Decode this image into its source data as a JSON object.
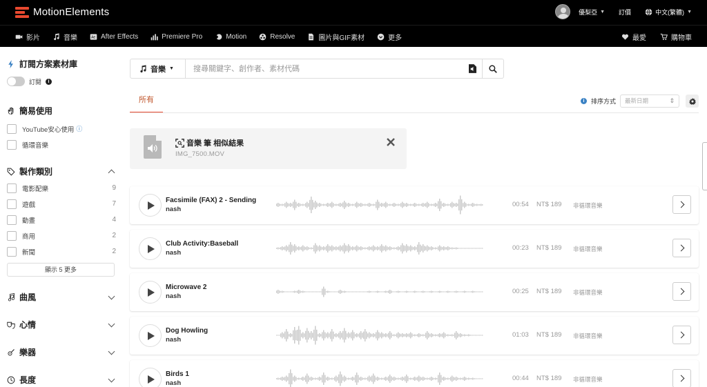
{
  "header": {
    "brand": "MotionElements",
    "username": "優梨亞",
    "subscribe": "訂價",
    "language": "中文(繁體)",
    "nav": [
      {
        "label": "影片",
        "icon": "video-icon"
      },
      {
        "label": "音樂",
        "icon": "music-note-icon"
      },
      {
        "label": "After Effects",
        "icon": "ae-icon"
      },
      {
        "label": "Premiere Pro",
        "icon": "premiere-icon"
      },
      {
        "label": "Motion",
        "icon": "motion-icon"
      },
      {
        "label": "Resolve",
        "icon": "resolve-icon"
      },
      {
        "label": "圖片與GIF素材",
        "icon": "image-icon"
      },
      {
        "label": "更多",
        "icon": "more-icon"
      }
    ],
    "favorites": "最愛",
    "cart": "購物車"
  },
  "sidebar": {
    "subscription_title": "訂閱方案素材庫",
    "subscription_toggle": "訂閱",
    "easy_use_title": "簡易使用",
    "easy_use_items": [
      {
        "label": "YouTube安心使用",
        "info": "ⓘ"
      },
      {
        "label": "循環音樂"
      }
    ],
    "category_title": "製作類別",
    "categories": [
      {
        "label": "電影配樂",
        "count": "9"
      },
      {
        "label": "遊戲",
        "count": "7"
      },
      {
        "label": "動畫",
        "count": "4"
      },
      {
        "label": "商用",
        "count": "2"
      },
      {
        "label": "新聞",
        "count": "2"
      }
    ],
    "show_more": "顯示 5 更多",
    "genre": "曲風",
    "mood": "心情",
    "instrument": "樂器",
    "duration": "長度"
  },
  "search": {
    "category": "音樂",
    "placeholder": "搜尋關鍵字、創作者、素材代碼"
  },
  "tabs": {
    "all": "所有"
  },
  "sort": {
    "label": "排序方式",
    "selected": "最新日期"
  },
  "similar": {
    "title": "音樂 筆 相似結果",
    "file": "IMG_7500.MOV"
  },
  "tracks": [
    {
      "title": "Facsimile (FAX) 2 - Sending",
      "artist": "nash",
      "duration": "00:54",
      "price": "NT$ 189",
      "loop": "非循環音樂"
    },
    {
      "title": "Club Activity:Baseball",
      "artist": "nash",
      "duration": "00:23",
      "price": "NT$ 189",
      "loop": "非循環音樂"
    },
    {
      "title": "Microwave 2",
      "artist": "nash",
      "duration": "00:25",
      "price": "NT$ 189",
      "loop": "非循環音樂"
    },
    {
      "title": "Dog Howling",
      "artist": "nash",
      "duration": "01:03",
      "price": "NT$ 189",
      "loop": "非循環音樂"
    },
    {
      "title": "Birds 1",
      "artist": "nash",
      "duration": "00:44",
      "price": "NT$ 189",
      "loop": "非循環音樂"
    }
  ],
  "colors": {
    "brand": "#e8492f",
    "header_bg": "#000000",
    "tab_active": "#c0562c",
    "info_blue": "#3b82c4"
  }
}
